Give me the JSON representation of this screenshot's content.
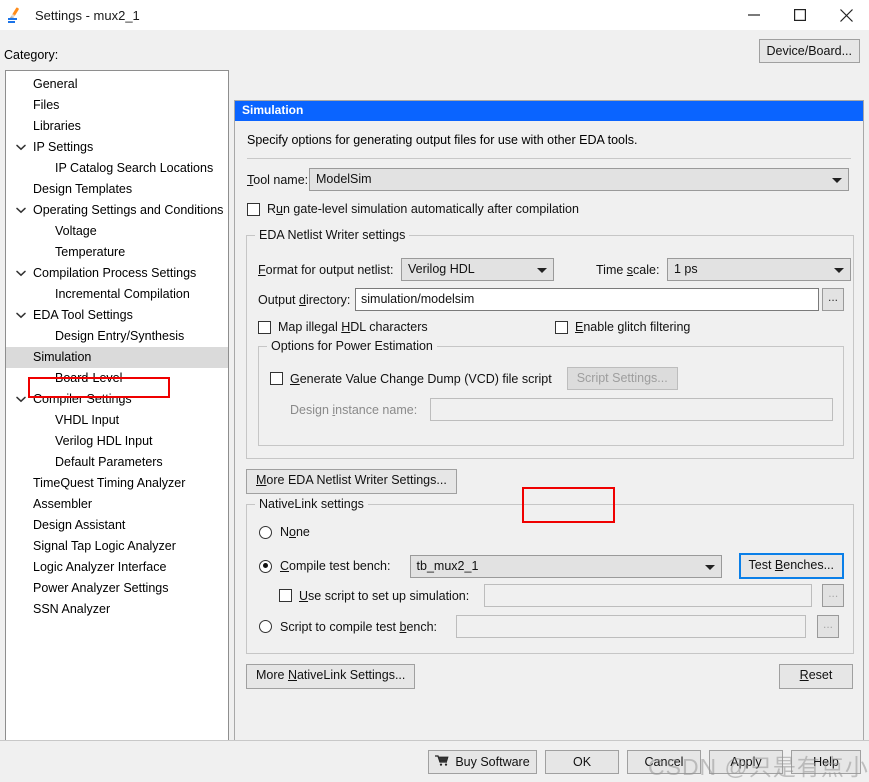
{
  "window": {
    "title": "Settings - mux2_1",
    "icon": "quartus-settings-icon",
    "minimize": "minimize-icon",
    "maximize": "maximize-icon",
    "close": "close-icon"
  },
  "toolbar": {
    "category_label": "Category:",
    "device_board_button": "Device/Board..."
  },
  "sidebar": {
    "items": [
      {
        "label": "General",
        "level": 0,
        "expander": "none",
        "selected": false
      },
      {
        "label": "Files",
        "level": 0,
        "expander": "none",
        "selected": false
      },
      {
        "label": "Libraries",
        "level": 0,
        "expander": "none",
        "selected": false
      },
      {
        "label": "IP Settings",
        "level": 0,
        "expander": "expanded",
        "selected": false
      },
      {
        "label": "IP Catalog Search Locations",
        "level": 1,
        "expander": "none",
        "selected": false
      },
      {
        "label": "Design Templates",
        "level": 0,
        "expander": "none",
        "selected": false
      },
      {
        "label": "Operating Settings and Conditions",
        "level": 0,
        "expander": "expanded",
        "selected": false
      },
      {
        "label": "Voltage",
        "level": 1,
        "expander": "none",
        "selected": false
      },
      {
        "label": "Temperature",
        "level": 1,
        "expander": "none",
        "selected": false
      },
      {
        "label": "Compilation Process Settings",
        "level": 0,
        "expander": "expanded",
        "selected": false
      },
      {
        "label": "Incremental Compilation",
        "level": 1,
        "expander": "none",
        "selected": false
      },
      {
        "label": "EDA Tool Settings",
        "level": 0,
        "expander": "expanded",
        "selected": false
      },
      {
        "label": "Design Entry/Synthesis",
        "level": 1,
        "expander": "none",
        "selected": false
      },
      {
        "label": "Simulation",
        "level": 1,
        "expander": "none",
        "selected": true
      },
      {
        "label": "Board-Level",
        "level": 1,
        "expander": "none",
        "selected": false
      },
      {
        "label": "Compiler Settings",
        "level": 0,
        "expander": "expanded",
        "selected": false
      },
      {
        "label": "VHDL Input",
        "level": 1,
        "expander": "none",
        "selected": false
      },
      {
        "label": "Verilog HDL Input",
        "level": 1,
        "expander": "none",
        "selected": false
      },
      {
        "label": "Default Parameters",
        "level": 1,
        "expander": "none",
        "selected": false
      },
      {
        "label": "TimeQuest Timing Analyzer",
        "level": 0,
        "expander": "none",
        "selected": false
      },
      {
        "label": "Assembler",
        "level": 0,
        "expander": "none",
        "selected": false
      },
      {
        "label": "Design Assistant",
        "level": 0,
        "expander": "none",
        "selected": false
      },
      {
        "label": "Signal Tap Logic Analyzer",
        "level": 0,
        "expander": "none",
        "selected": false
      },
      {
        "label": "Logic Analyzer Interface",
        "level": 0,
        "expander": "none",
        "selected": false
      },
      {
        "label": "Power Analyzer Settings",
        "level": 0,
        "expander": "none",
        "selected": false
      },
      {
        "label": "SSN Analyzer",
        "level": 0,
        "expander": "none",
        "selected": false
      }
    ]
  },
  "panel": {
    "header": "Simulation",
    "description": "Specify options for generating output files for use with other EDA tools.",
    "tool_name_label": "Tool name:",
    "tool_name_value": "ModelSim",
    "run_gate_level_label": "Run gate-level simulation automatically after compilation",
    "run_gate_level_checked": false,
    "netlist_group": {
      "title": "EDA Netlist Writer settings",
      "format_label": "Format for output netlist:",
      "format_value": "Verilog HDL",
      "timescale_label": "Time scale:",
      "timescale_value": "1 ps",
      "output_dir_label": "Output directory:",
      "output_dir_value": "simulation/modelsim",
      "browse_label": "...",
      "map_illegal_label": "Map illegal HDL characters",
      "map_illegal_checked": false,
      "glitch_label": "Enable glitch filtering",
      "glitch_checked": false,
      "power_group": {
        "title": "Options for Power Estimation",
        "vcd_label": "Generate Value Change Dump (VCD) file script",
        "vcd_checked": false,
        "script_settings_button": "Script Settings...",
        "design_instance_label": "Design instance name:",
        "design_instance_value": ""
      }
    },
    "more_eda_button": "More EDA Netlist Writer Settings...",
    "nativelink_group": {
      "title": "NativeLink settings",
      "none_label": "None",
      "none_selected": false,
      "compile_tb_label": "Compile test bench:",
      "compile_tb_selected": true,
      "compile_tb_value": "tb_mux2_1",
      "test_benches_button": "Test Benches...",
      "use_script_label": "Use script to set up simulation:",
      "use_script_checked": false,
      "use_script_value": "",
      "script_compile_label": "Script to compile test bench:",
      "script_compile_selected": false,
      "script_compile_value": "",
      "browse_label": "..."
    },
    "more_nativelink_button": "More NativeLink Settings...",
    "reset_button": "Reset"
  },
  "footer": {
    "buy_software": "Buy Software",
    "buy_icon": "shopping-cart-icon",
    "ok": "OK",
    "cancel": "Cancel",
    "apply": "Apply",
    "help": "Help"
  },
  "watermark": {
    "text": "CSDN @只是有点小怂"
  },
  "colors": {
    "header_blue": "#0a64ff",
    "annotation_red": "#ef0000",
    "focus_blue": "#0a7fe8",
    "selection_gray": "#dadada"
  }
}
